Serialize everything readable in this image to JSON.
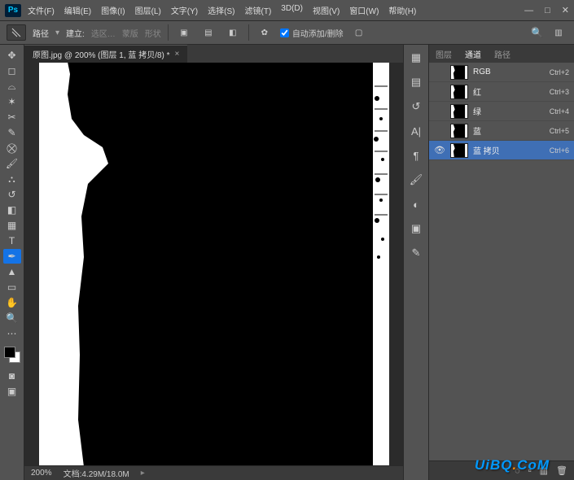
{
  "app": {
    "logo": "Ps"
  },
  "menubar": {
    "file": "文件(F)",
    "edit": "编辑(E)",
    "image": "图像(I)",
    "layer": "图层(L)",
    "type": "文字(Y)",
    "select": "选择(S)",
    "filter": "滤镜(T)",
    "threed": "3D(D)",
    "view": "视图(V)",
    "window": "窗口(W)",
    "help": "帮助(H)"
  },
  "window_controls": {
    "min": "—",
    "max": "□",
    "close": "✕"
  },
  "options": {
    "mode_label": "路径",
    "create_label": "建立:",
    "select_label": "选区…",
    "mask_label": "蒙版",
    "shape_label": "形状",
    "auto_label": "自动添加/删除",
    "auto_checked": true
  },
  "document": {
    "tab_title": "原图.jpg @ 200% (图层 1, 蓝 拷贝/8) *",
    "zoom": "200%",
    "docinfo": "文档:4.29M/18.0M"
  },
  "panels": {
    "tabs": {
      "layers": "图层",
      "channels": "通道",
      "paths": "路径"
    },
    "channels": [
      {
        "name": "RGB",
        "shortcut": "Ctrl+2",
        "visible": false
      },
      {
        "name": "红",
        "shortcut": "Ctrl+3",
        "visible": false
      },
      {
        "name": "绿",
        "shortcut": "Ctrl+4",
        "visible": false
      },
      {
        "name": "蓝",
        "shortcut": "Ctrl+5",
        "visible": false
      },
      {
        "name": "蓝 拷贝",
        "shortcut": "Ctrl+6",
        "visible": true
      }
    ]
  },
  "watermark": {
    "text1": "UiBQ",
    "dot": ".",
    "text2": "CoM"
  }
}
